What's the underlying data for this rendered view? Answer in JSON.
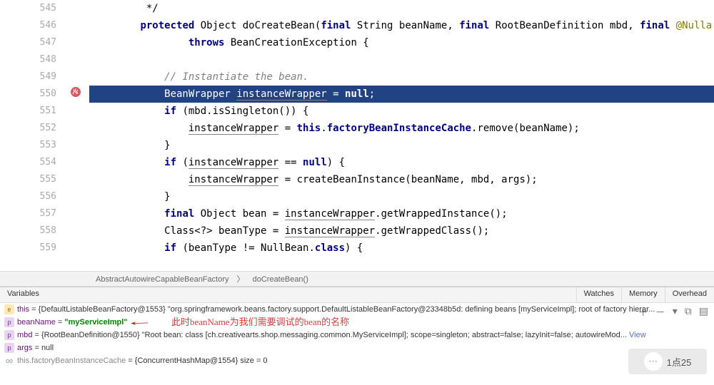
{
  "lines": [
    {
      "num": "545",
      "code": "         */"
    },
    {
      "num": "546",
      "code": "        protected Object doCreateBean(final String beanName, final RootBeanDefinition mbd, final @Nulla",
      "tokens": [
        {
          "t": "        ",
          "c": ""
        },
        {
          "t": "protected",
          "c": "kw"
        },
        {
          "t": " Object doCreateBean(",
          "c": ""
        },
        {
          "t": "final",
          "c": "kw"
        },
        {
          "t": " String beanName, ",
          "c": ""
        },
        {
          "t": "final",
          "c": "kw"
        },
        {
          "t": " RootBeanDefinition mbd, ",
          "c": ""
        },
        {
          "t": "final",
          "c": "kw"
        },
        {
          "t": " ",
          "c": ""
        },
        {
          "t": "@Nulla",
          "c": "anno"
        }
      ]
    },
    {
      "num": "547",
      "code": "                throws BeanCreationException {",
      "tokens": [
        {
          "t": "                ",
          "c": ""
        },
        {
          "t": "throws",
          "c": "kw"
        },
        {
          "t": " BeanCreationException {",
          "c": ""
        }
      ]
    },
    {
      "num": "548",
      "code": ""
    },
    {
      "num": "549",
      "code": "            // Instantiate the bean.",
      "tokens": [
        {
          "t": "            ",
          "c": ""
        },
        {
          "t": "// Instantiate the bean.",
          "c": "comment"
        }
      ]
    },
    {
      "num": "550",
      "code": "            BeanWrapper instanceWrapper = null;",
      "hl": true,
      "tokens": [
        {
          "t": "            BeanWrapper ",
          "c": ""
        },
        {
          "t": "instanceWrapper",
          "c": "underline"
        },
        {
          "t": " = ",
          "c": ""
        },
        {
          "t": "null",
          "c": "kw"
        },
        {
          "t": ";",
          "c": ""
        }
      ]
    },
    {
      "num": "551",
      "code": "            if (mbd.isSingleton()) {",
      "tokens": [
        {
          "t": "            ",
          "c": ""
        },
        {
          "t": "if",
          "c": "kw"
        },
        {
          "t": " (mbd.isSingleton()) {",
          "c": ""
        }
      ]
    },
    {
      "num": "552",
      "code": "                instanceWrapper = this.factoryBeanInstanceCache.remove(beanName);",
      "tokens": [
        {
          "t": "                ",
          "c": ""
        },
        {
          "t": "instanceWrapper",
          "c": "underline"
        },
        {
          "t": " = ",
          "c": ""
        },
        {
          "t": "this",
          "c": "kw"
        },
        {
          "t": ".",
          "c": ""
        },
        {
          "t": "factoryBeanInstanceCache",
          "c": "kw"
        },
        {
          "t": ".remove(beanName);",
          "c": ""
        }
      ]
    },
    {
      "num": "553",
      "code": "            }"
    },
    {
      "num": "554",
      "code": "            if (instanceWrapper == null) {",
      "tokens": [
        {
          "t": "            ",
          "c": ""
        },
        {
          "t": "if",
          "c": "kw"
        },
        {
          "t": " (",
          "c": ""
        },
        {
          "t": "instanceWrapper",
          "c": "underline"
        },
        {
          "t": " == ",
          "c": ""
        },
        {
          "t": "null",
          "c": "kw"
        },
        {
          "t": ") {",
          "c": ""
        }
      ]
    },
    {
      "num": "555",
      "code": "                instanceWrapper = createBeanInstance(beanName, mbd, args);",
      "tokens": [
        {
          "t": "                ",
          "c": ""
        },
        {
          "t": "instanceWrapper",
          "c": "underline"
        },
        {
          "t": " = createBeanInstance(beanName, mbd, args);",
          "c": ""
        }
      ]
    },
    {
      "num": "556",
      "code": "            }"
    },
    {
      "num": "557",
      "code": "            final Object bean = instanceWrapper.getWrappedInstance();",
      "tokens": [
        {
          "t": "            ",
          "c": ""
        },
        {
          "t": "final",
          "c": "kw"
        },
        {
          "t": " Object bean = ",
          "c": ""
        },
        {
          "t": "instanceWrapper",
          "c": "underline"
        },
        {
          "t": ".getWrappedInstance();",
          "c": ""
        }
      ]
    },
    {
      "num": "558",
      "code": "            Class<?> beanType = instanceWrapper.getWrappedClass();",
      "tokens": [
        {
          "t": "            Class<?> beanType = ",
          "c": ""
        },
        {
          "t": "instanceWrapper",
          "c": "underline"
        },
        {
          "t": ".getWrappedClass();",
          "c": ""
        }
      ]
    },
    {
      "num": "559",
      "code": "            if (beanType != NullBean.class) {",
      "tokens": [
        {
          "t": "            ",
          "c": ""
        },
        {
          "t": "if",
          "c": "kw"
        },
        {
          "t": " (beanType != NullBean.",
          "c": ""
        },
        {
          "t": "class",
          "c": "kw"
        },
        {
          "t": ") {",
          "c": ""
        }
      ]
    }
  ],
  "breakpointLine": "550",
  "breadcrumb": {
    "a": "AbstractAutowireCapableBeanFactory",
    "sep": "〉",
    "b": "doCreateBean()"
  },
  "tabs": {
    "variables": "Variables",
    "watches": "Watches",
    "memory": "Memory",
    "overhead": "Overhead"
  },
  "variables": [
    {
      "icon": "e",
      "iconCls": "icon-e",
      "name": "this",
      "rest": " = {DefaultListableBeanFactory@1553} \"org.springframework.beans.factory.support.DefaultListableBeanFactory@23348b5d: defining beans [myServiceImpl]; root of factory hierar..."
    },
    {
      "icon": "p",
      "iconCls": "icon-p",
      "name": "beanName",
      "rest": " = ",
      "str": "\"myServiceImpl\"",
      "annotation": "此时beanName为我们需要调试的bean的名称",
      "arrow": true
    },
    {
      "icon": "p",
      "iconCls": "icon-p",
      "name": "mbd",
      "rest": " = {RootBeanDefinition@1550} \"Root bean: class [ch.creativearts.shop.messaging.common.MyServiceImpl]; scope=singleton; abstract=false; lazyInit=false; autowireMod...",
      "view": " View"
    },
    {
      "icon": "p",
      "iconCls": "icon-p",
      "name": "args",
      "rest": " = null"
    },
    {
      "icon": "oo",
      "iconCls": "icon-oo",
      "name": "this.factoryBeanInstanceCache",
      "nameCls": "var-type",
      "rest": " = {ConcurrentHashMap@1554}  size = 0"
    }
  ],
  "watermark": "1点25",
  "toolbarIcons": {
    "plus": "＋",
    "minus": "－",
    "down": "▾",
    "copy": "⧉",
    "layers": "▤"
  }
}
